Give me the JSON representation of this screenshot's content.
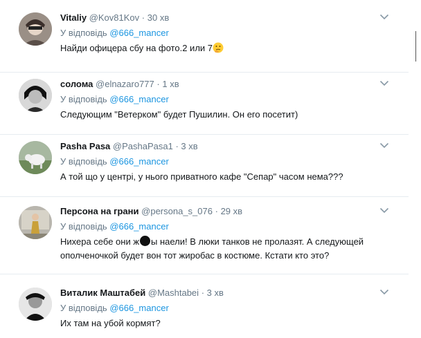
{
  "tweets": [
    {
      "name": "Vitaliy",
      "handle": "@Kov81Kov",
      "time": "30 хв",
      "reply_prefix": "У відповідь",
      "reply_to": "@666_mancer",
      "text": "Найди офицера сбу на фото.2 или 7",
      "emoji": "thinking-face"
    },
    {
      "name": "солома",
      "handle": "@elnazaro777",
      "time": "1 хв",
      "reply_prefix": "У відповідь",
      "reply_to": "@666_mancer",
      "text": "Следующим \"Ветерком\" будет Пушилин. Он его посетит)"
    },
    {
      "name": "Pasha Pasa",
      "handle": "@PashaPasa1",
      "time": "3 хв",
      "reply_prefix": "У відповідь",
      "reply_to": "@666_mancer",
      "text": "А той що у центрі, у нього приватного кафе \"Сепар\" часом нема???"
    },
    {
      "name": "Персона на грани",
      "handle": "@persona_s_076",
      "time": "29 хв",
      "reply_prefix": "У відповідь",
      "reply_to": "@666_mancer",
      "text_a": "Нихера себе они  ж",
      "text_b": "ы наели! В люки танков не пролазят. А следующей ополченочкой будет вон тот жиробас в костюме. Кстати кто это?"
    },
    {
      "name": "Виталик Маштабей",
      "handle": "@Mashtabei",
      "time": "3 хв",
      "reply_prefix": "У відповідь",
      "reply_to": "@666_mancer",
      "text": "Их там на убой кормят?"
    }
  ],
  "separator": "·",
  "colors": {
    "name": "#14171a",
    "meta": "#657786",
    "mention": "#1b95e0",
    "divider": "#e6ecf0"
  },
  "icons": {
    "more": "chevron-down-icon",
    "emoji": "thinking-face"
  }
}
